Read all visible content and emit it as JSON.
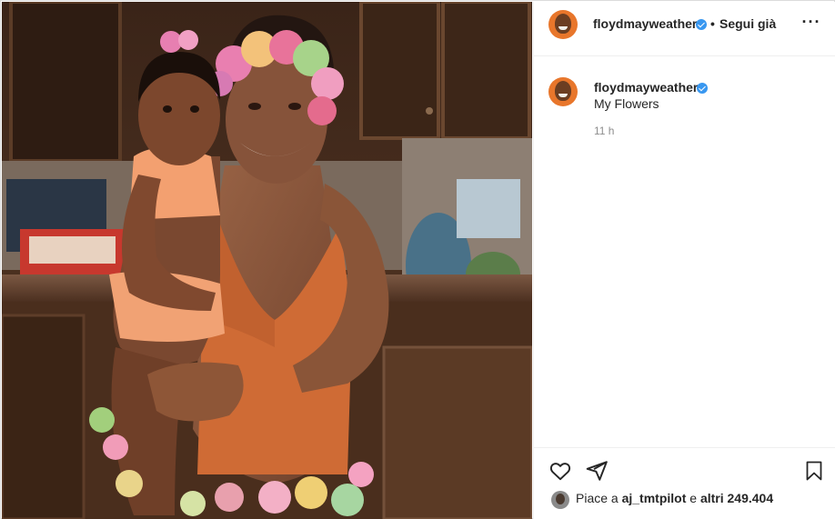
{
  "post": {
    "author": "floydmayweather",
    "follow_separator": "•",
    "follow_label": "Segui già",
    "more_label": "···",
    "caption_author": "floydmayweather",
    "caption_text": "My Flowers",
    "timestamp": "11 h"
  },
  "actions": {
    "like_icon": "heart-icon",
    "share_icon": "send-icon",
    "save_icon": "bookmark-icon"
  },
  "likes": {
    "prefix": "Piace a",
    "user": "aj_tmtpilot",
    "middle": "e",
    "others": "altri 249.404"
  },
  "colors": {
    "verified_badge": "#3897f0",
    "avatar_bg": "#e8762b",
    "timestamp_text": "#8e8e8e"
  }
}
